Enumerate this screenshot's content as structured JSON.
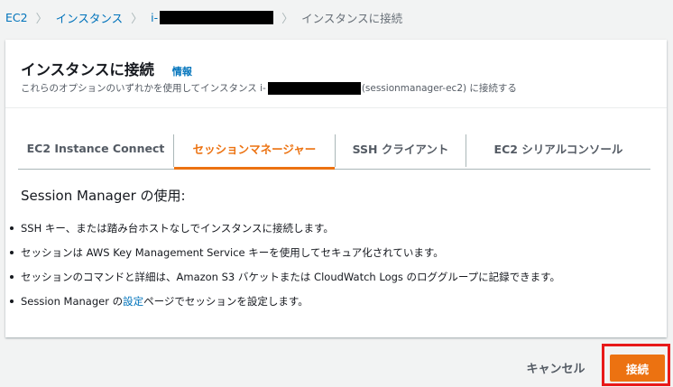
{
  "breadcrumb": {
    "ec2": "EC2",
    "instances": "インスタンス",
    "instance_prefix": "i-",
    "current": "インスタンスに接続"
  },
  "header": {
    "title": "インスタンスに接続",
    "info": "情報",
    "desc_prefix": "これらのオプションのいずれかを使用してインスタンス i-",
    "desc_suffix": "(sessionmanager-ec2) に接続する"
  },
  "tabs": [
    {
      "label": "EC2 Instance Connect",
      "active": false
    },
    {
      "label": "セッションマネージャー",
      "active": true
    },
    {
      "label": "SSH クライアント",
      "active": false
    },
    {
      "label": "EC2 シリアルコンソール",
      "active": false
    }
  ],
  "content": {
    "title": "Session Manager の使用:",
    "bullet1": "SSH キー、または踏み台ホストなしでインスタンスに接続します。",
    "bullet2": "セッションは AWS Key Management Service キーを使用してセキュア化されています。",
    "bullet3": "セッションのコマンドと詳細は、Amazon S3 バケットまたは CloudWatch Logs のロググループに記録できます。",
    "bullet4_before": "Session Manager の",
    "bullet4_link": "設定",
    "bullet4_after": "ページでセッションを設定します。"
  },
  "footer": {
    "cancel": "キャンセル",
    "connect": "接続"
  },
  "colors": {
    "accent": "#ec7211",
    "link": "#0073bb",
    "highlight": "#e81919"
  }
}
